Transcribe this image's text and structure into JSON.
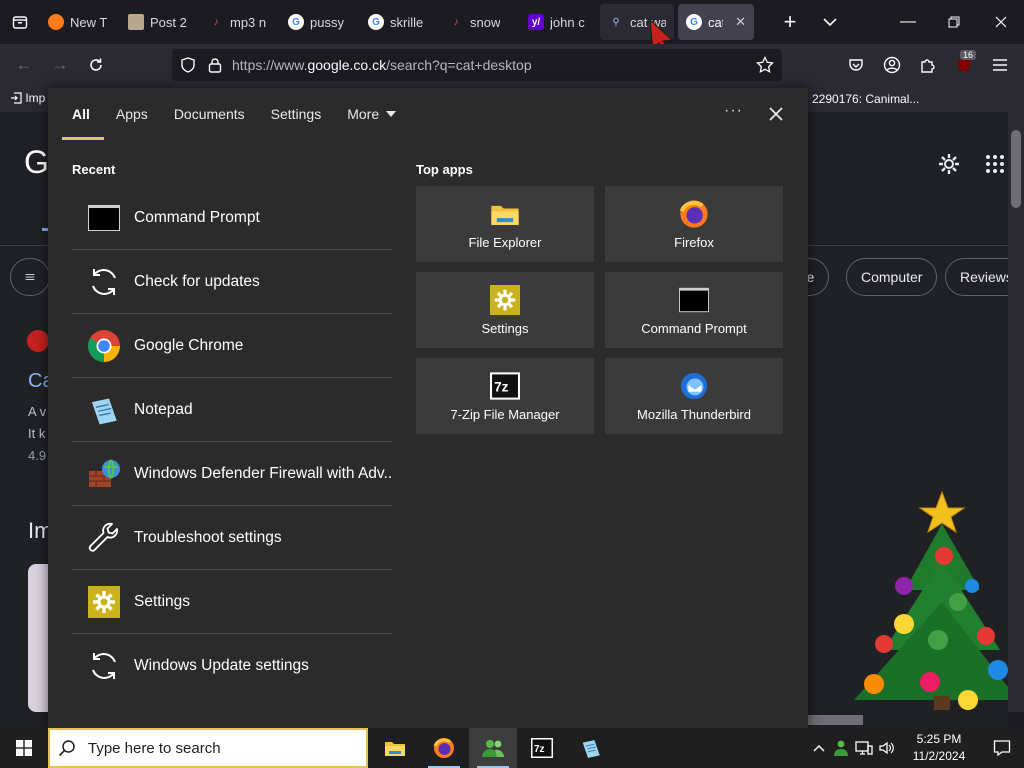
{
  "browser": {
    "tabs": [
      {
        "title": "New T",
        "favicon": "firefox-icon",
        "state": "normal"
      },
      {
        "title": "Post 2",
        "favicon": "image-icon",
        "state": "normal"
      },
      {
        "title": "mp3 n",
        "favicon": "music-icon",
        "state": "normal"
      },
      {
        "title": "pussy",
        "favicon": "google-icon",
        "state": "normal"
      },
      {
        "title": "skrille",
        "favicon": "google-icon",
        "state": "normal"
      },
      {
        "title": "snow",
        "favicon": "music-icon",
        "state": "normal"
      },
      {
        "title": "john c",
        "favicon": "yahoo-icon",
        "state": "normal"
      },
      {
        "title": "cat wa",
        "favicon": "search-icon",
        "state": "muted"
      },
      {
        "title": "cat",
        "favicon": "google-icon",
        "state": "active"
      }
    ],
    "url_prefix": "https://www.",
    "url_host": "google.co.ck",
    "url_path": "/search?q=cat+desktop",
    "extensions_badge": "16",
    "bookmarks_left": "Imp",
    "bookmarks_right": "2290176: Canimal..."
  },
  "google_page": {
    "logo_letter": "G",
    "chips": [
      "ree",
      "Computer",
      "Reviews"
    ],
    "result_fragments": [
      "Ca",
      "A v",
      "It k",
      "4.9",
      "Im"
    ]
  },
  "search_panel": {
    "tabs": [
      {
        "label": "All",
        "active": true
      },
      {
        "label": "Apps",
        "active": false
      },
      {
        "label": "Documents",
        "active": false
      },
      {
        "label": "Settings",
        "active": false
      },
      {
        "label": "More",
        "active": false
      }
    ],
    "recent_title": "Recent",
    "recent": [
      {
        "label": "Command Prompt",
        "icon": "cmd-icon"
      },
      {
        "label": "Check for updates",
        "icon": "sync-icon"
      },
      {
        "label": "Google Chrome",
        "icon": "chrome-icon"
      },
      {
        "label": "Notepad",
        "icon": "notepad-icon"
      },
      {
        "label": "Windows Defender Firewall with Adv...",
        "icon": "firewall-icon"
      },
      {
        "label": "Troubleshoot settings",
        "icon": "wrench-icon"
      },
      {
        "label": "Settings",
        "icon": "gear-icon"
      },
      {
        "label": "Windows Update settings",
        "icon": "sync-icon"
      }
    ],
    "topapps_title": "Top apps",
    "topapps": [
      {
        "label": "File Explorer",
        "icon": "folder-icon"
      },
      {
        "label": "Firefox",
        "icon": "firefox-icon"
      },
      {
        "label": "Settings",
        "icon": "gear-icon"
      },
      {
        "label": "Command Prompt",
        "icon": "cmd-icon"
      },
      {
        "label": "7-Zip File Manager",
        "icon": "7zip-icon"
      },
      {
        "label": "Mozilla Thunderbird",
        "icon": "thunderbird-icon"
      }
    ]
  },
  "taskbar": {
    "search_placeholder": "Type here to search",
    "time": "5:25 PM",
    "date": "11/2/2024"
  }
}
